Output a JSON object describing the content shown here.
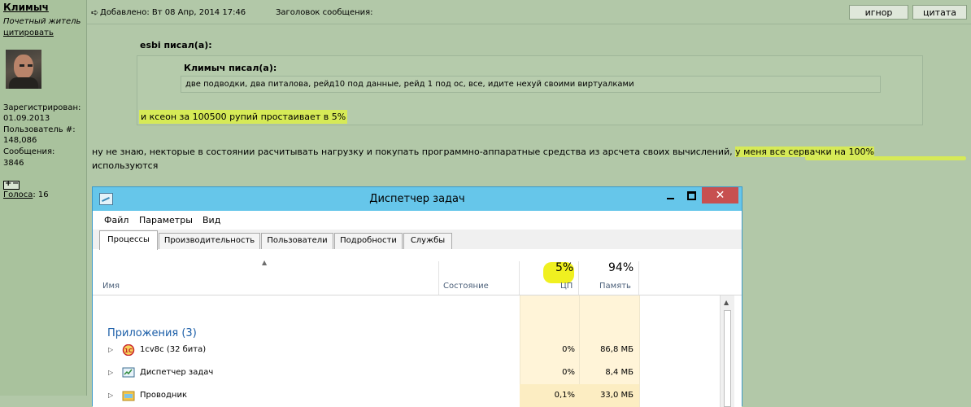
{
  "user": {
    "name": "Климыч",
    "rank": "Почетный житель",
    "quote_link": "цитировать",
    "registered_label": "Зарегистрирован:",
    "registered_date": "01.09.2013",
    "user_number_label": "Пользователь #:",
    "user_number": "148,086",
    "messages_label": "Сообщения:",
    "messages": "3846",
    "votes_label": "Голоса",
    "votes_value": ": 16"
  },
  "post": {
    "added": "Добавлено: Вт 08 Апр, 2014 17:46",
    "subject_label": "Заголовок сообщения:",
    "ignore_button": "игнор",
    "quote_button": "цитата",
    "quote1_title": "esbi писал(а):",
    "quote2_title": "Климыч писал(а):",
    "quote2_text": "две подводки, два питалова, рейд10 под данные, рейд 1 под ос, все, идите нехуй своими виртуалками",
    "quote1_text": "и ксеон за 100500 рупий простаивает в 5%",
    "body_line1": "ну не знаю, некторые в состоянии расчитывать нагрузку и покупать программно-аппаратные средства из арсчета своих вычислений, ",
    "body_highlight": "у меня все сервачки на 100%",
    "body_line2": "используются"
  },
  "taskmanager": {
    "title": "Диспетчер задач",
    "menu": [
      "Файл",
      "Параметры",
      "Вид"
    ],
    "tabs": [
      "Процессы",
      "Производительность",
      "Пользователи",
      "Подробности",
      "Службы"
    ],
    "columns": {
      "name": "Имя",
      "status": "Состояние",
      "cpu_pct": "5%",
      "cpu": "ЦП",
      "mem_pct": "94%",
      "mem": "Память"
    },
    "group": "Приложения (3)",
    "processes": [
      {
        "name": "1cv8c (32 бита)",
        "cpu": "0%",
        "mem": "86,8 МБ"
      },
      {
        "name": "Диспетчер задач",
        "cpu": "0%",
        "mem": "8,4 МБ"
      },
      {
        "name": "Проводник",
        "cpu": "0,1%",
        "mem": "33,0 МБ"
      }
    ]
  },
  "colors": {
    "forum_bg": "#b2c8a8",
    "highlight": "#d6ea57",
    "titlebar": "#66c6ea",
    "close_button": "#c75050"
  }
}
